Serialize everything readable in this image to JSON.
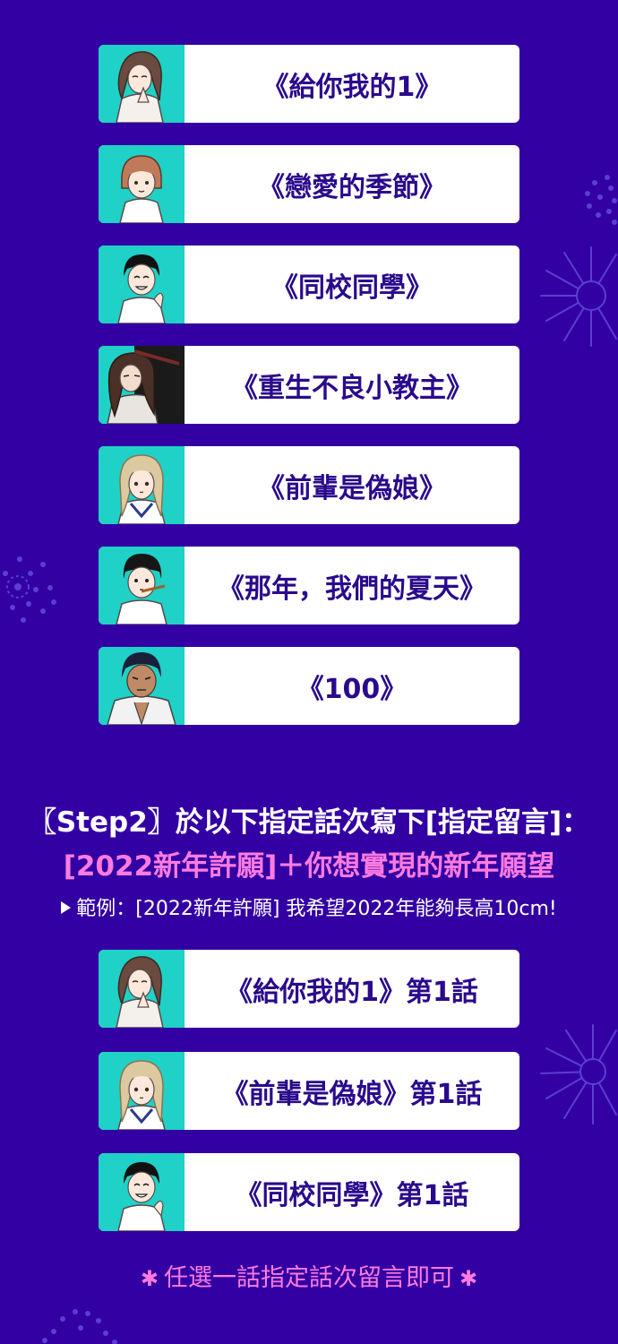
{
  "colors": {
    "background": "#3300a3",
    "card_bg": "#ffffff",
    "card_text": "#2a0a8c",
    "thumb_bg": "#1fd1c6",
    "accent_pink": "#ff7be0",
    "white": "#ffffff"
  },
  "series_list": [
    {
      "title": "《給你我的1》",
      "avatar": "girl-hands-folded-avatar"
    },
    {
      "title": "《戀愛的季節》",
      "avatar": "short-hair-girl-avatar"
    },
    {
      "title": "《同校同學》",
      "avatar": "smiling-boy-avatar"
    },
    {
      "title": "《重生不良小教主》",
      "avatar": "long-hair-man-avatar"
    },
    {
      "title": "《前輩是偽娘》",
      "avatar": "blonde-sailor-avatar"
    },
    {
      "title": "《那年，我們的夏天》",
      "avatar": "boy-with-pencil-avatar"
    },
    {
      "title": "《100》",
      "avatar": "muscular-man-avatar"
    }
  ],
  "step2": {
    "heading": "〖Step2〗於以下指定話次寫下[指定留言]：",
    "wish_line": "[2022新年許願]＋你想實現的新年願望",
    "example_label": "範例：[2022新年許願] 我希望2022年能夠長高10cm!"
  },
  "episode_list": [
    {
      "title": "《給你我的1》第1話",
      "avatar": "girl-hands-folded-avatar"
    },
    {
      "title": "《前輩是偽娘》第1話",
      "avatar": "blonde-sailor-avatar"
    },
    {
      "title": "《同校同學》第1話",
      "avatar": "smiling-boy-avatar"
    }
  ],
  "footnote": {
    "star": "✱",
    "text": "任選一話指定話次留言即可"
  }
}
